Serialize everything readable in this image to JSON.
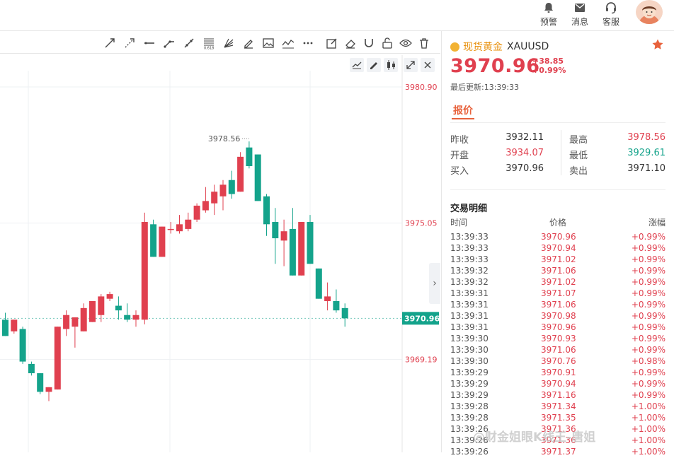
{
  "header": {
    "alert_label": "预警",
    "message_label": "消息",
    "service_label": "客服"
  },
  "chart_data": {
    "type": "candlestick",
    "y_ticks": [
      "3980.90",
      "3975.05",
      "3969.19"
    ],
    "y_tick_values": [
      3980.9,
      3975.05,
      3969.19
    ],
    "ylim": [
      3965.2,
      3981.6
    ],
    "current_price": "3970.96",
    "current_value": 3970.96,
    "high_annotation": "3978.56",
    "high_value": 3978.56,
    "colors": {
      "up": "#e0404f",
      "down": "#14a38b"
    },
    "candles": [
      {
        "o": 3970.9,
        "h": 3971.2,
        "l": 3970.2,
        "c": 3970.2
      },
      {
        "o": 3970.4,
        "h": 3970.9,
        "l": 3970.3,
        "c": 3970.9
      },
      {
        "o": 3970.5,
        "h": 3970.6,
        "l": 3969.0,
        "c": 3969.1
      },
      {
        "o": 3969.0,
        "h": 3969.1,
        "l": 3968.5,
        "c": 3968.6
      },
      {
        "o": 3968.6,
        "h": 3968.6,
        "l": 3967.7,
        "c": 3967.8
      },
      {
        "o": 3967.8,
        "h": 3968.0,
        "l": 3967.4,
        "c": 3968.0
      },
      {
        "o": 3967.9,
        "h": 3970.6,
        "l": 3967.9,
        "c": 3970.6
      },
      {
        "o": 3970.5,
        "h": 3971.3,
        "l": 3970.2,
        "c": 3971.1
      },
      {
        "o": 3970.6,
        "h": 3971.0,
        "l": 3969.7,
        "c": 3971.0
      },
      {
        "o": 3970.4,
        "h": 3971.6,
        "l": 3970.4,
        "c": 3971.4
      },
      {
        "o": 3970.8,
        "h": 3971.7,
        "l": 3970.8,
        "c": 3971.7
      },
      {
        "o": 3971.1,
        "h": 3972.0,
        "l": 3970.8,
        "c": 3971.9
      },
      {
        "o": 3971.8,
        "h": 3972.1,
        "l": 3971.7,
        "c": 3972.0
      },
      {
        "o": 3971.5,
        "h": 3971.9,
        "l": 3970.9,
        "c": 3971.3
      },
      {
        "o": 3971.1,
        "h": 3971.6,
        "l": 3970.8,
        "c": 3970.9
      },
      {
        "o": 3970.9,
        "h": 3971.3,
        "l": 3970.6,
        "c": 3971.1
      },
      {
        "o": 3970.9,
        "h": 3975.5,
        "l": 3970.7,
        "c": 3975.1
      },
      {
        "o": 3975.0,
        "h": 3975.2,
        "l": 3973.6,
        "c": 3973.6
      },
      {
        "o": 3973.6,
        "h": 3974.9,
        "l": 3973.6,
        "c": 3974.9
      },
      {
        "o": 3974.8,
        "h": 3975.1,
        "l": 3974.6,
        "c": 3974.8
      },
      {
        "o": 3974.7,
        "h": 3975.4,
        "l": 3974.6,
        "c": 3975.0
      },
      {
        "o": 3974.8,
        "h": 3975.5,
        "l": 3974.7,
        "c": 3975.2
      },
      {
        "o": 3975.2,
        "h": 3975.9,
        "l": 3975.1,
        "c": 3975.8
      },
      {
        "o": 3975.6,
        "h": 3976.6,
        "l": 3975.5,
        "c": 3976.0
      },
      {
        "o": 3975.9,
        "h": 3976.7,
        "l": 3975.4,
        "c": 3976.4
      },
      {
        "o": 3976.2,
        "h": 3976.9,
        "l": 3975.6,
        "c": 3976.7
      },
      {
        "o": 3976.9,
        "h": 3977.3,
        "l": 3976.1,
        "c": 3976.3
      },
      {
        "o": 3976.4,
        "h": 3978.1,
        "l": 3976.4,
        "c": 3977.9
      },
      {
        "o": 3978.3,
        "h": 3978.56,
        "l": 3977.4,
        "c": 3977.5
      },
      {
        "o": 3978.0,
        "h": 3978.0,
        "l": 3976.0,
        "c": 3976.0
      },
      {
        "o": 3976.2,
        "h": 3976.3,
        "l": 3974.5,
        "c": 3975.0
      },
      {
        "o": 3975.1,
        "h": 3975.7,
        "l": 3973.3,
        "c": 3974.4
      },
      {
        "o": 3974.3,
        "h": 3975.2,
        "l": 3973.2,
        "c": 3974.7
      },
      {
        "o": 3974.8,
        "h": 3975.7,
        "l": 3972.8,
        "c": 3972.8
      },
      {
        "o": 3972.8,
        "h": 3975.1,
        "l": 3972.8,
        "c": 3975.1
      },
      {
        "o": 3975.1,
        "h": 3975.4,
        "l": 3973.3,
        "c": 3973.3
      },
      {
        "o": 3973.1,
        "h": 3973.1,
        "l": 3971.8,
        "c": 3971.8
      },
      {
        "o": 3971.7,
        "h": 3972.5,
        "l": 3971.3,
        "c": 3971.9
      },
      {
        "o": 3971.7,
        "h": 3972.2,
        "l": 3971.2,
        "c": 3971.3
      },
      {
        "o": 3971.4,
        "h": 3971.6,
        "l": 3970.6,
        "c": 3970.96
      }
    ]
  },
  "quote": {
    "name": "现货黄金",
    "symbol": "XAUUSD",
    "price": "3970.96",
    "change": "+38.85",
    "change_pct": "+0.99%",
    "updated": "最后更新:13:39:33",
    "tab": "报价",
    "stats": [
      {
        "l1": "昨收",
        "v1": "3932.11",
        "c1": "#333333",
        "l2": "最高",
        "v2": "3978.56",
        "c2": "#e0404f"
      },
      {
        "l1": "开盘",
        "v1": "3934.07",
        "c1": "#e0404f",
        "l2": "最低",
        "v2": "3929.61",
        "c2": "#14a38b"
      },
      {
        "l1": "买入",
        "v1": "3970.96",
        "c1": "#333333",
        "l2": "卖出",
        "v2": "3971.10",
        "c2": "#333333"
      }
    ]
  },
  "trades": {
    "title": "交易明细",
    "head_time": "时间",
    "head_price": "价格",
    "head_change": "涨幅",
    "rows": [
      [
        "13:39:33",
        "3970.96",
        "+0.99%"
      ],
      [
        "13:39:33",
        "3970.94",
        "+0.99%"
      ],
      [
        "13:39:33",
        "3971.02",
        "+0.99%"
      ],
      [
        "13:39:32",
        "3971.06",
        "+0.99%"
      ],
      [
        "13:39:32",
        "3971.02",
        "+0.99%"
      ],
      [
        "13:39:31",
        "3971.07",
        "+0.99%"
      ],
      [
        "13:39:31",
        "3971.06",
        "+0.99%"
      ],
      [
        "13:39:31",
        "3970.98",
        "+0.99%"
      ],
      [
        "13:39:31",
        "3970.96",
        "+0.99%"
      ],
      [
        "13:39:30",
        "3970.93",
        "+0.99%"
      ],
      [
        "13:39:30",
        "3971.06",
        "+0.99%"
      ],
      [
        "13:39:30",
        "3970.76",
        "+0.98%"
      ],
      [
        "13:39:29",
        "3970.91",
        "+0.99%"
      ],
      [
        "13:39:29",
        "3970.94",
        "+0.99%"
      ],
      [
        "13:39:29",
        "3971.16",
        "+0.99%"
      ],
      [
        "13:39:28",
        "3971.34",
        "+1.00%"
      ],
      [
        "13:39:28",
        "3971.35",
        "+1.00%"
      ],
      [
        "13:39:26",
        "3971.36",
        "+1.00%"
      ],
      [
        "13:39:26",
        "3971.36",
        "+1.00%"
      ],
      [
        "13:39:26",
        "3971.37",
        "+1.00%"
      ]
    ]
  },
  "watermark": "@财金姐眼K线王-唐姐"
}
